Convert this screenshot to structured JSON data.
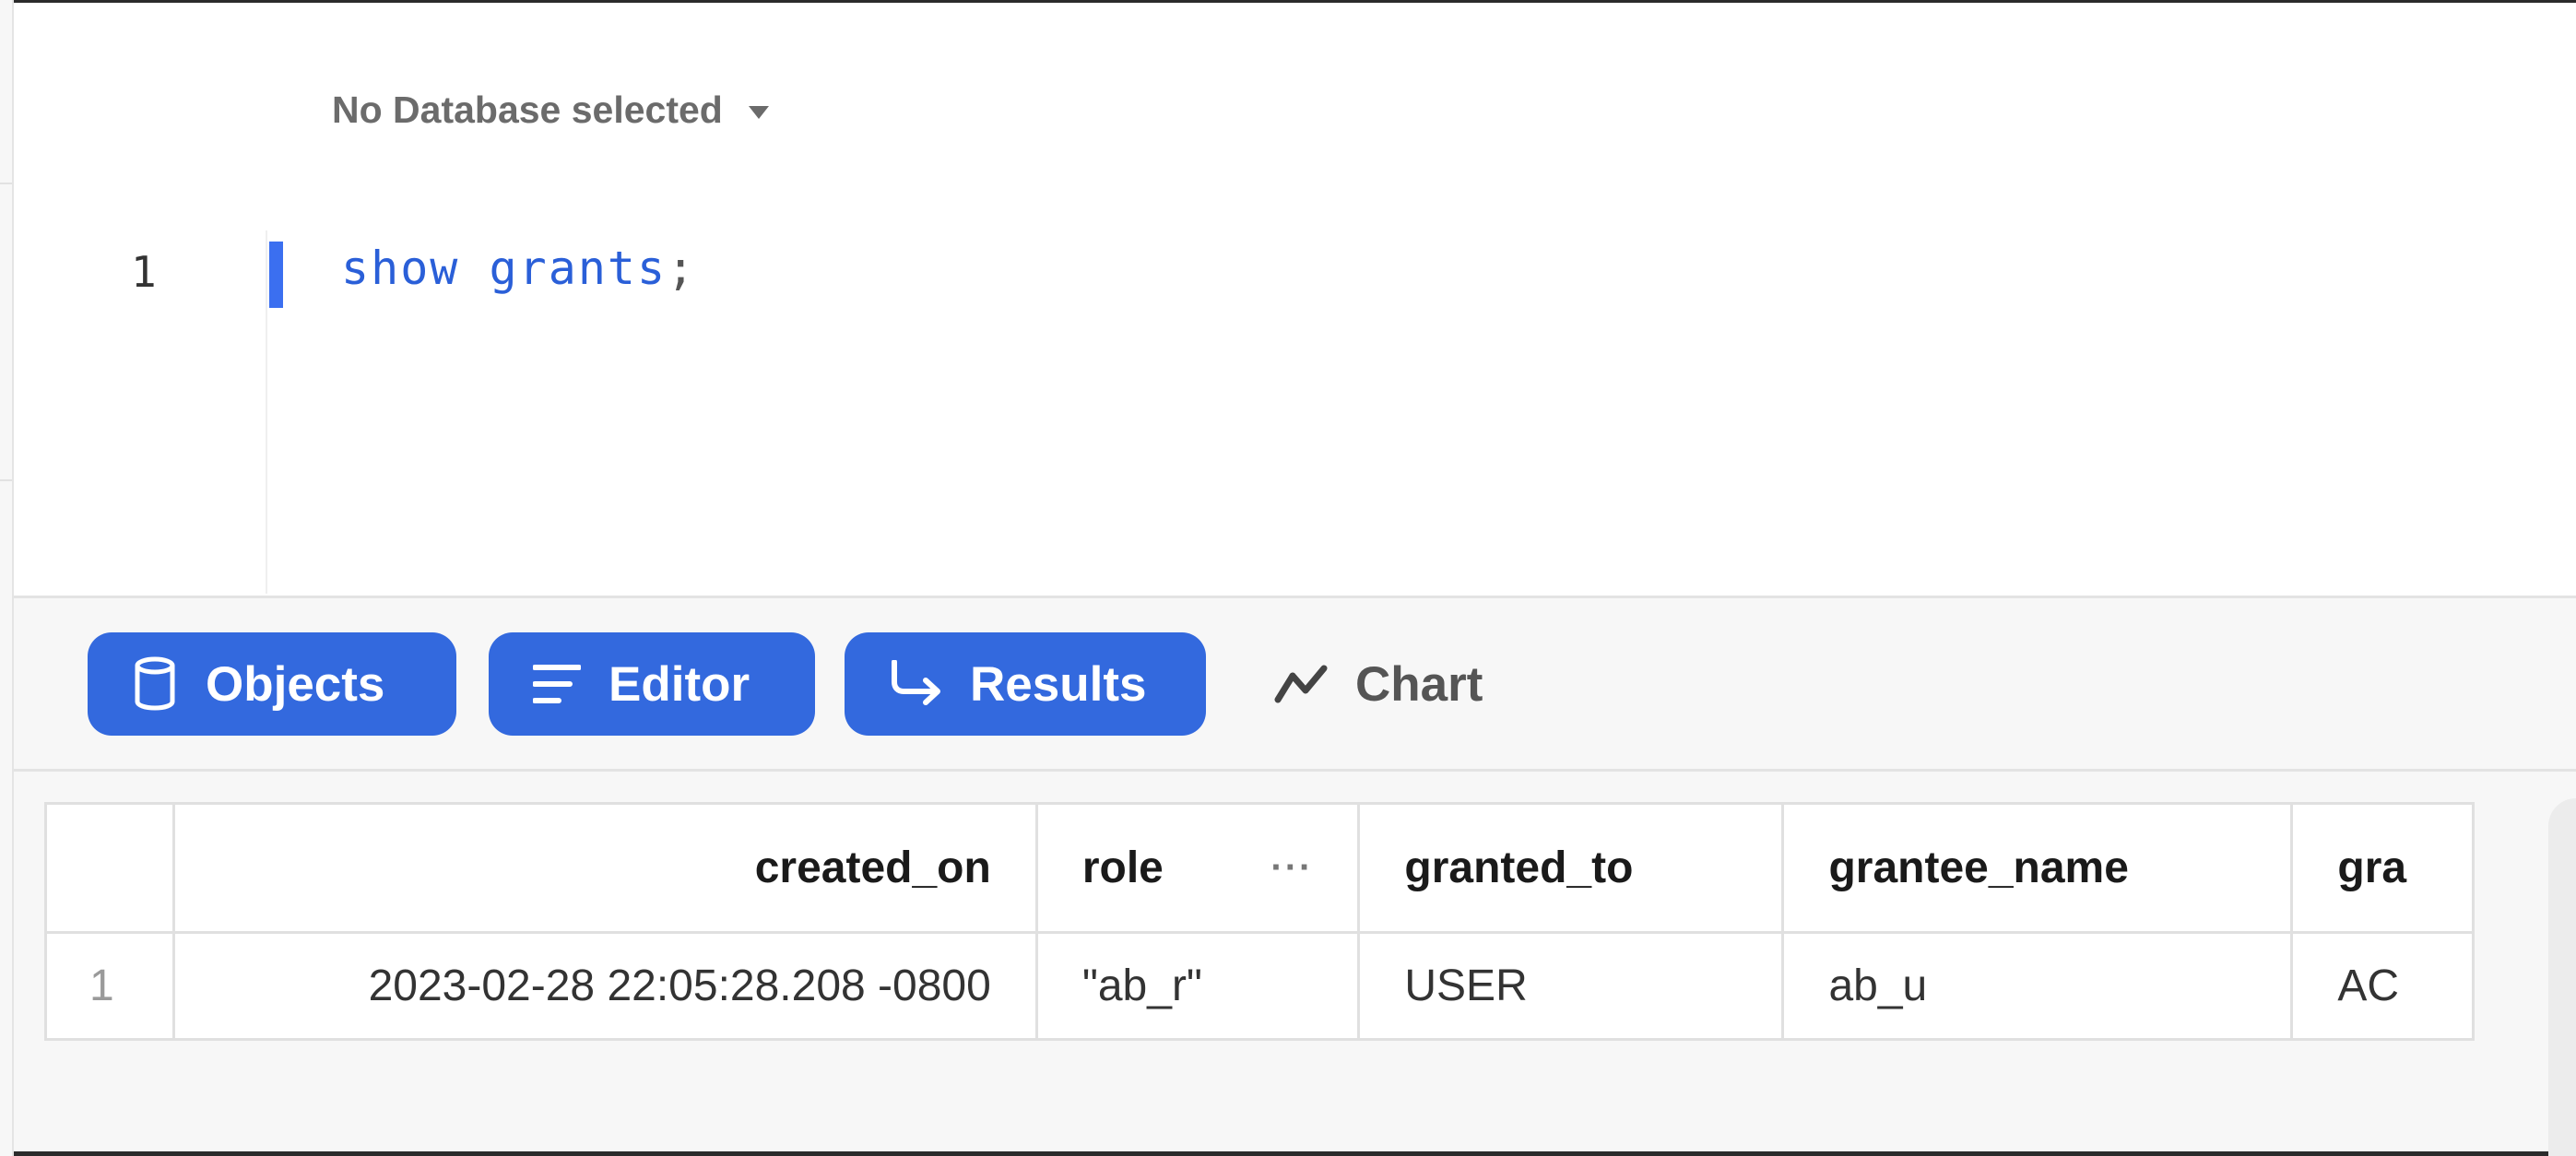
{
  "editor": {
    "database_selector": "No Database selected",
    "line_number": "1",
    "code_keyword": "show grants",
    "code_punct": ";"
  },
  "toolbar": {
    "objects_label": "Objects",
    "editor_label": "Editor",
    "results_label": "Results",
    "chart_label": "Chart",
    "accent_color": "#3369de"
  },
  "table": {
    "columns": [
      "created_on",
      "role",
      "granted_to",
      "grantee_name",
      "gra"
    ],
    "rows": [
      {
        "index": "1",
        "created_on": "2023-02-28 22:05:28.208 -0800",
        "role": "\"ab_r\"",
        "granted_to": "USER",
        "grantee_name": "ab_u",
        "gra": "AC"
      }
    ]
  },
  "icons": {
    "objects": "database-icon",
    "editor": "lines-icon",
    "results": "arrow-return-icon",
    "chart": "line-chart-icon",
    "column_menu": "more-horizontal-icon"
  }
}
